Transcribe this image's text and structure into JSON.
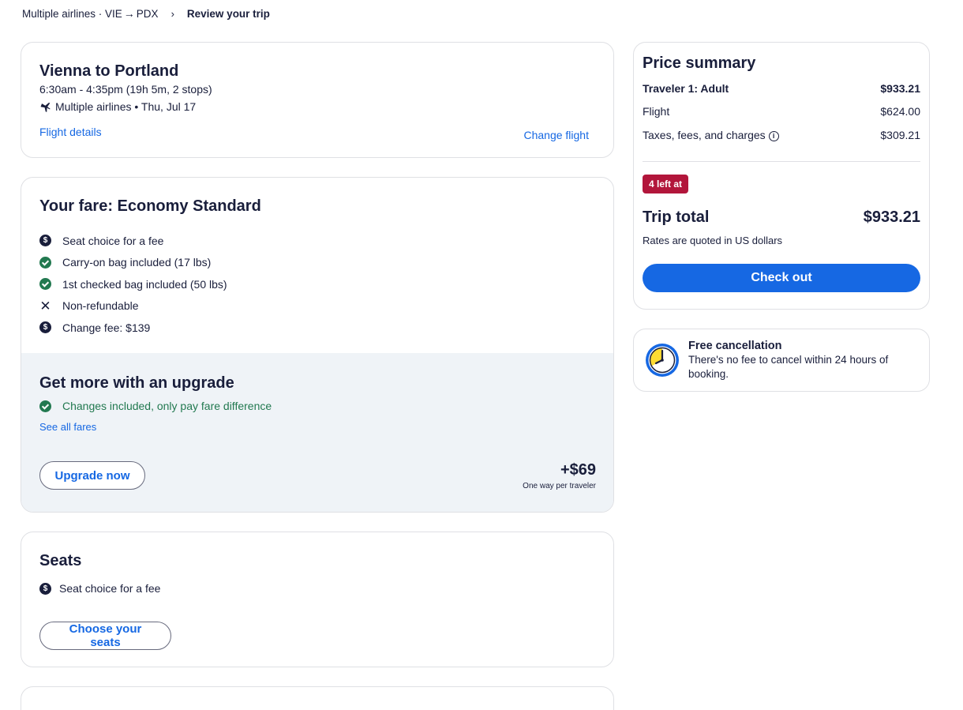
{
  "breadcrumb": {
    "airlines": "Multiple airlines · VIE",
    "arrow": "→",
    "dest": "PDX",
    "separator": "›",
    "current": "Review your trip"
  },
  "flight": {
    "title": "Vienna to Portland",
    "times": "6:30am - 4:35pm (19h 5m, 2 stops)",
    "airline_date": "Multiple airlines • Thu, Jul 17",
    "details_link": "Flight details",
    "change_link": "Change flight"
  },
  "fare": {
    "title": "Your fare: Economy Standard",
    "features": [
      {
        "icon": "dollar-icon",
        "text": "Seat choice for a fee"
      },
      {
        "icon": "check-icon",
        "text": "Carry-on bag included (17 lbs)"
      },
      {
        "icon": "check-icon",
        "text": "1st checked bag included (50 lbs)"
      },
      {
        "icon": "x-icon",
        "text": "Non-refundable"
      },
      {
        "icon": "dollar-icon",
        "text": "Change fee: $139"
      }
    ]
  },
  "upgrade": {
    "title": "Get more with an upgrade",
    "feature": "Changes included, only pay fare difference",
    "see_all": "See all fares",
    "button": "Upgrade now",
    "price": "+$69",
    "price_note": "One way per traveler"
  },
  "seats": {
    "title": "Seats",
    "feature": "Seat choice for a fee",
    "button": "Choose your seats"
  },
  "price_summary": {
    "title": "Price summary",
    "traveler_label": "Traveler 1: Adult",
    "traveler_amount": "$933.21",
    "flight_label": "Flight",
    "flight_amount": "$624.00",
    "taxes_label": "Taxes, fees, and charges",
    "taxes_amount": "$309.21",
    "badge": "4 left at",
    "total_label": "Trip total",
    "total_amount": "$933.21",
    "rates_note": "Rates are quoted in US dollars",
    "checkout": "Check out"
  },
  "cancellation": {
    "title": "Free cancellation",
    "description": "There's no fee to cancel within 24 hours of booking."
  },
  "colors": {
    "primary": "#1668e3",
    "text": "#191e3b",
    "success": "#227950",
    "badge": "#b2163b",
    "upgrade_bg": "#eff3f7"
  }
}
